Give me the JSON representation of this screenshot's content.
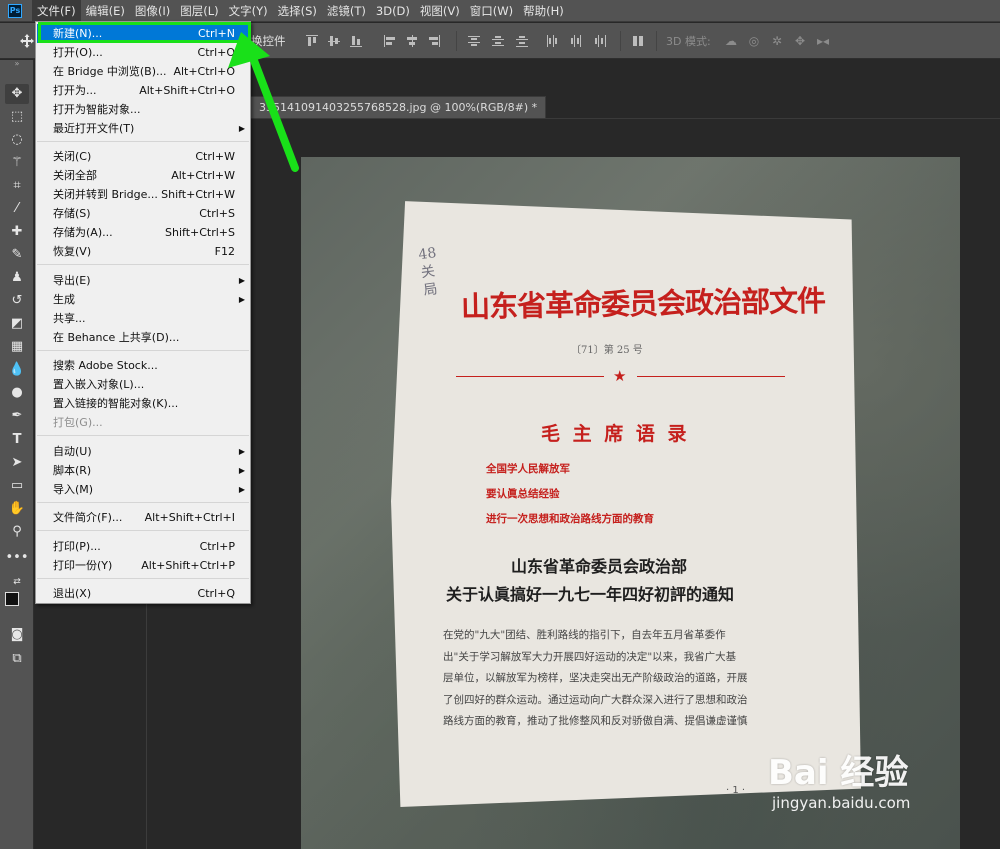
{
  "menubar": {
    "app_icon": "Ps",
    "items": [
      "文件(F)",
      "编辑(E)",
      "图像(I)",
      "图层(L)",
      "文字(Y)",
      "选择(S)",
      "滤镜(T)",
      "3D(D)",
      "视图(V)",
      "窗口(W)",
      "帮助(H)"
    ]
  },
  "optionsbar": {
    "show_transform_label": "换控件",
    "mode_3d_label": "3D 模式:"
  },
  "document": {
    "tab_title": "335141091403255768528.jpg @ 100%(RGB/8#) *"
  },
  "file_menu": {
    "items": [
      {
        "label": "新建(N)...",
        "shortcut": "Ctrl+N",
        "state": "highlighted"
      },
      {
        "label": "打开(O)...",
        "shortcut": "Ctrl+O"
      },
      {
        "label": "在 Bridge 中浏览(B)...",
        "shortcut": "Alt+Ctrl+O"
      },
      {
        "label": "打开为...",
        "shortcut": "Alt+Shift+Ctrl+O"
      },
      {
        "label": "打开为智能对象...",
        "shortcut": ""
      },
      {
        "label": "最近打开文件(T)",
        "shortcut": "",
        "submenu": true
      },
      {
        "label": "关闭(C)",
        "shortcut": "Ctrl+W"
      },
      {
        "label": "关闭全部",
        "shortcut": "Alt+Ctrl+W"
      },
      {
        "label": "关闭并转到 Bridge...",
        "shortcut": "Shift+Ctrl+W"
      },
      {
        "label": "存储(S)",
        "shortcut": "Ctrl+S"
      },
      {
        "label": "存储为(A)...",
        "shortcut": "Shift+Ctrl+S"
      },
      {
        "label": "恢复(V)",
        "shortcut": "F12"
      },
      {
        "label": "导出(E)",
        "shortcut": "",
        "submenu": true
      },
      {
        "label": "生成",
        "shortcut": "",
        "submenu": true
      },
      {
        "label": "共享...",
        "shortcut": ""
      },
      {
        "label": "在 Behance 上共享(D)...",
        "shortcut": ""
      },
      {
        "label": "搜索 Adobe Stock...",
        "shortcut": ""
      },
      {
        "label": "置入嵌入对象(L)...",
        "shortcut": ""
      },
      {
        "label": "置入链接的智能对象(K)...",
        "shortcut": ""
      },
      {
        "label": "打包(G)...",
        "shortcut": "",
        "state": "disabled"
      },
      {
        "label": "自动(U)",
        "shortcut": "",
        "submenu": true
      },
      {
        "label": "脚本(R)",
        "shortcut": "",
        "submenu": true
      },
      {
        "label": "导入(M)",
        "shortcut": "",
        "submenu": true
      },
      {
        "label": "文件简介(F)...",
        "shortcut": "Alt+Shift+Ctrl+I"
      },
      {
        "label": "打印(P)...",
        "shortcut": "Ctrl+P"
      },
      {
        "label": "打印一份(Y)",
        "shortcut": "Alt+Shift+Ctrl+P"
      },
      {
        "label": "退出(X)",
        "shortcut": "Ctrl+Q"
      }
    ]
  },
  "photo": {
    "handwriting": [
      "48",
      "关",
      "局"
    ],
    "title": "山东省革命委员会政治部文件",
    "doc_number": "〔71〕第 25 号",
    "quote_title": "毛 主 席 语 录",
    "quotes": [
      "全国学人民解放军",
      "要认眞总结经验",
      "进行一次思想和政治路线方面的教育"
    ],
    "heading_1": "山东省革命委员会政治部",
    "heading_2": "关于认眞搞好一九七一年四好初評的通知",
    "body_lines": [
      "在党的\"九大\"团结、胜利路线的指引下，自去年五月省革委作",
      "出\"关于学习解放军大力开展四好运动的决定\"以来，我省广大基",
      "层单位，以解放军为榜样，坚决走突出无产阶级政治的道路，开展",
      "了创四好的群众运动。通过运动向广大群众深入进行了思想和政治",
      "路线方面的教育，推动了批修整风和反对骄傲自满、提倡谦虚谨慎"
    ],
    "page_number": "· 1 ·"
  },
  "watermark": {
    "logo": "Bai 经验",
    "url": "jingyan.baidu.com"
  }
}
